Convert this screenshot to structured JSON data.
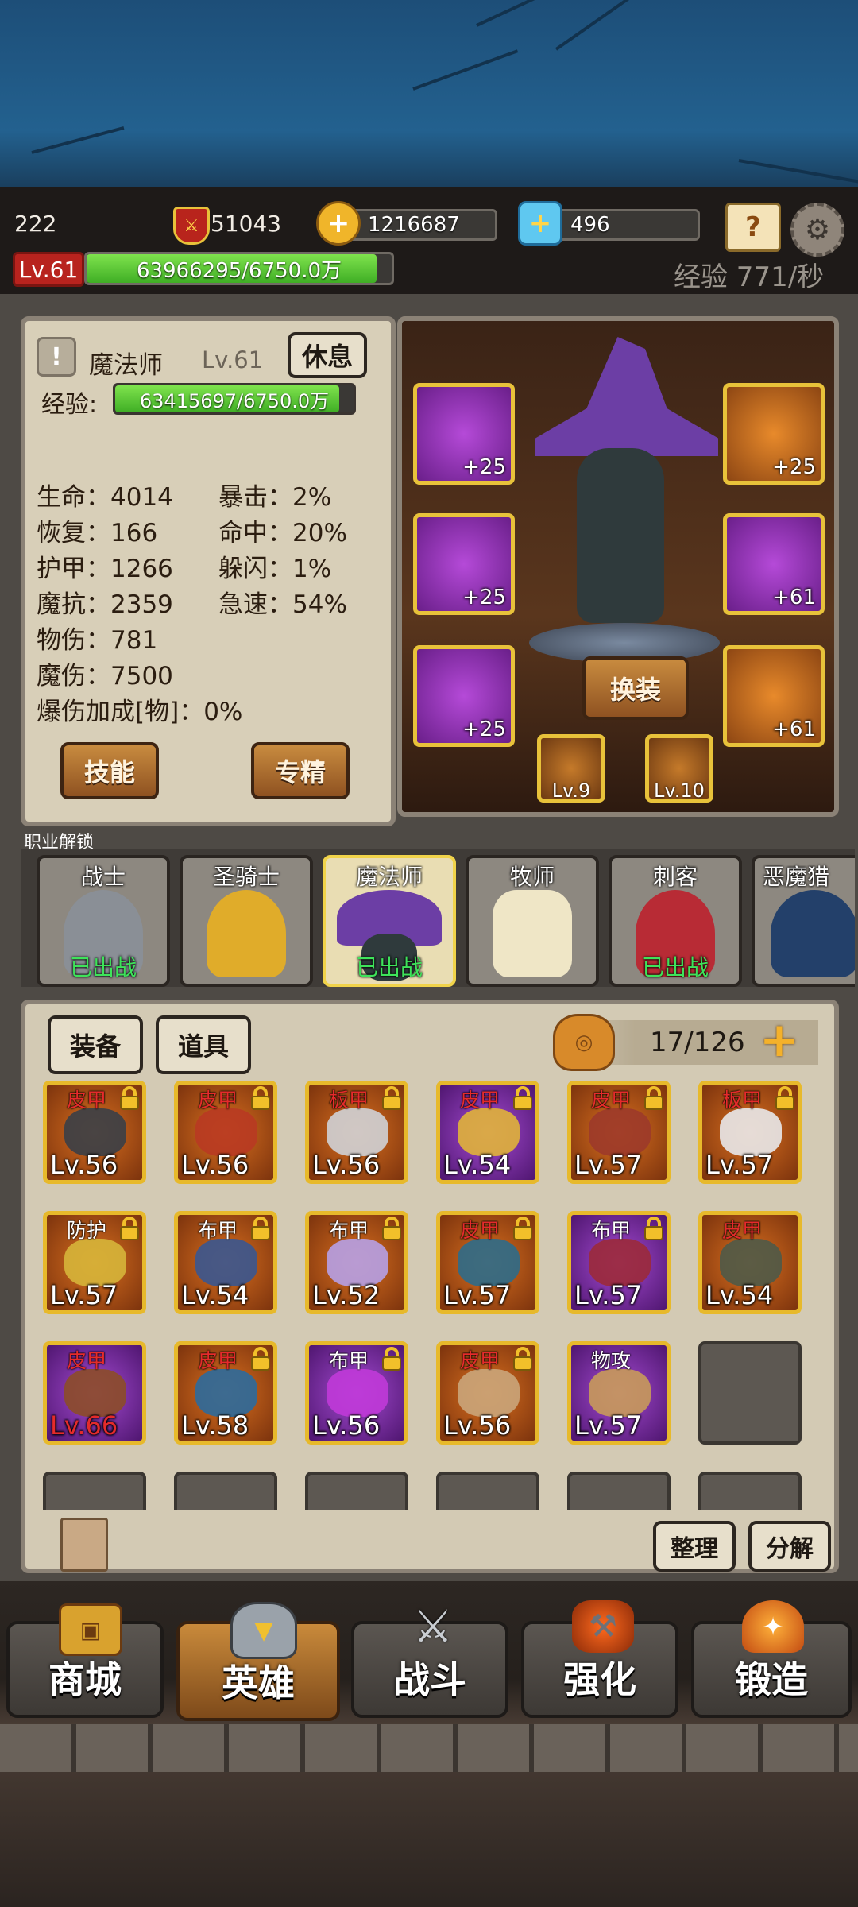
{
  "hud": {
    "player_number": "222",
    "power": "51043",
    "gold": "1216687",
    "gems": "496",
    "level_badge": "Lv.61",
    "exp_bar_text": "63966295/6750.0万",
    "exp_bar_fraction": 0.95,
    "exp_rate": "经验 771/秒",
    "icons": [
      "sword-shield-icon",
      "gold-plus-icon",
      "gem-plus-icon",
      "quest-book-icon",
      "settings-gear-icon"
    ]
  },
  "hero_panel": {
    "class_name": "魔法师",
    "level": "Lv.61",
    "rest_button": "休息",
    "exp_label": "经验:",
    "exp_text": "63415697/6750.0万",
    "exp_fraction": 0.94,
    "stats_left": [
      "生命：4014",
      "恢复：166",
      "护甲：1266",
      "魔抗：2359",
      "物伤：781",
      "魔伤：7500",
      "爆伤加成[物]：0%"
    ],
    "stats_right": [
      "暴击：2%",
      "命中：20%",
      "躲闪：1%",
      "急速：54%"
    ],
    "skill_button": "技能",
    "specialize_button": "专精"
  },
  "equipment": {
    "slots": [
      {
        "name": "helmet-slot",
        "plus": "+25",
        "color": "purple"
      },
      {
        "name": "armor-slot",
        "plus": "+25",
        "color": "purple"
      },
      {
        "name": "boots-slot",
        "plus": "+25",
        "color": "purple"
      },
      {
        "name": "amulet-slot",
        "plus": "+25",
        "color": "orange"
      },
      {
        "name": "weapon-slot",
        "plus": "+61",
        "color": "purple"
      },
      {
        "name": "ring-slot",
        "plus": "+61",
        "color": "orange"
      }
    ],
    "change_button": "换装",
    "gem1_level": "Lv.9",
    "gem2_level": "Lv.10"
  },
  "class_unlock": {
    "title": "职业解锁",
    "heroes": [
      {
        "name": "战士",
        "status": "已出战"
      },
      {
        "name": "圣骑士",
        "status": ""
      },
      {
        "name": "魔法师",
        "status": "已出战"
      },
      {
        "name": "牧师",
        "status": ""
      },
      {
        "name": "刺客",
        "status": "已出战"
      },
      {
        "name": "恶魔猎",
        "status": ""
      }
    ]
  },
  "inventory": {
    "tab_equip": "装备",
    "tab_items": "道具",
    "capacity": "17/126",
    "sort_button": "整理",
    "decompose_button": "分解",
    "items": [
      {
        "type": "皮甲",
        "lv": "Lv.56",
        "color": "orange",
        "locked": true
      },
      {
        "type": "皮甲",
        "lv": "Lv.56",
        "color": "orange",
        "locked": true
      },
      {
        "type": "板甲",
        "lv": "Lv.56",
        "color": "orange",
        "locked": true
      },
      {
        "type": "皮甲",
        "lv": "Lv.54",
        "color": "purple",
        "locked": true
      },
      {
        "type": "皮甲",
        "lv": "Lv.57",
        "color": "orange",
        "locked": true
      },
      {
        "type": "板甲",
        "lv": "Lv.57",
        "color": "orange",
        "locked": true
      },
      {
        "type": "防护",
        "lv": "Lv.57",
        "color": "orange",
        "locked": true,
        "white": true
      },
      {
        "type": "布甲",
        "lv": "Lv.54",
        "color": "orange",
        "locked": true,
        "white": true
      },
      {
        "type": "布甲",
        "lv": "Lv.52",
        "color": "orange",
        "locked": true,
        "white": true
      },
      {
        "type": "皮甲",
        "lv": "Lv.57",
        "color": "orange",
        "locked": true
      },
      {
        "type": "布甲",
        "lv": "Lv.57",
        "color": "purple",
        "locked": true,
        "white": true
      },
      {
        "type": "皮甲",
        "lv": "Lv.54",
        "color": "orange",
        "locked": false
      },
      {
        "type": "皮甲",
        "lv": "Lv.66",
        "color": "purple",
        "locked": false,
        "redlv": true
      },
      {
        "type": "皮甲",
        "lv": "Lv.58",
        "color": "orange",
        "locked": true
      },
      {
        "type": "布甲",
        "lv": "Lv.56",
        "color": "purple",
        "locked": true,
        "white": true
      },
      {
        "type": "皮甲",
        "lv": "Lv.56",
        "color": "orange",
        "locked": true
      },
      {
        "type": "物攻",
        "lv": "Lv.57",
        "color": "purple",
        "locked": false,
        "white": true
      }
    ]
  },
  "nav": [
    "商城",
    "英雄",
    "战斗",
    "强化",
    "锻造"
  ],
  "nav_active": 1
}
